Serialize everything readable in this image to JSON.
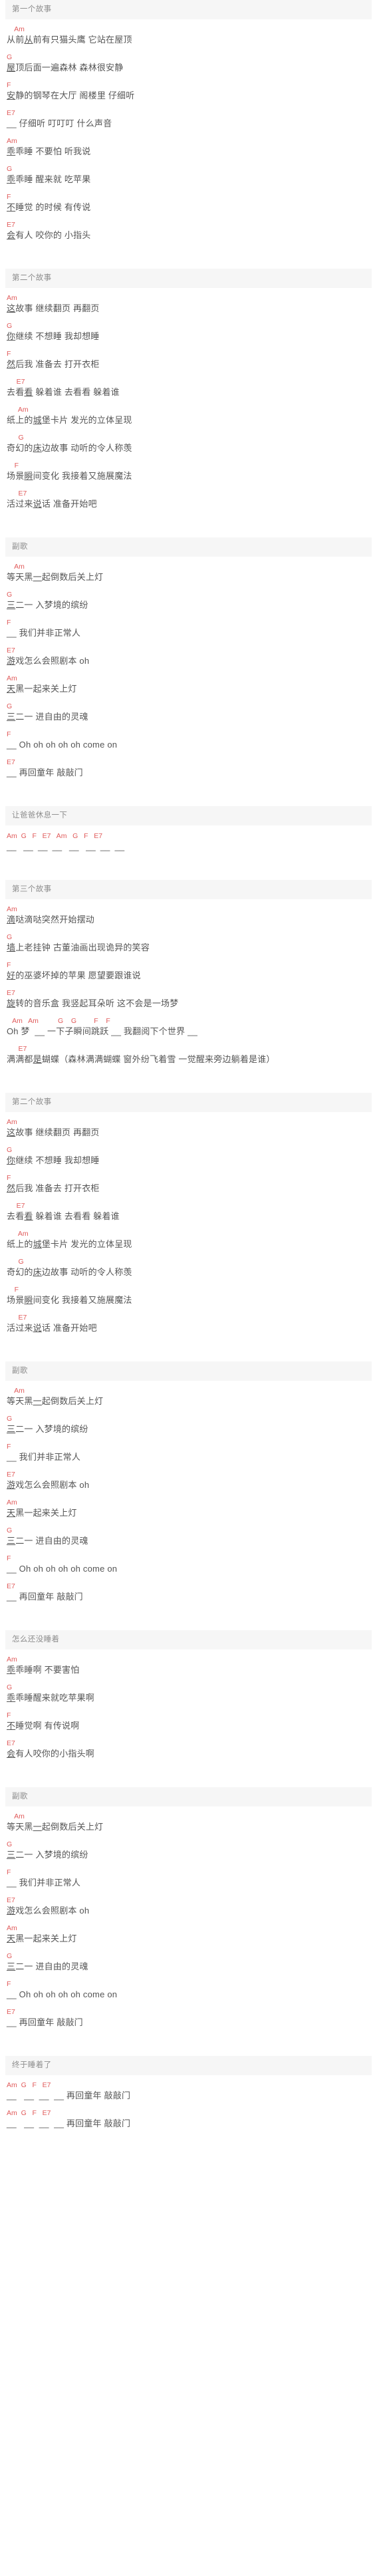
{
  "meta": {
    "chord_color": "#e05a5a",
    "lyric_color": "#555555",
    "header_bg": "#f6f6f6",
    "header_color": "#8d8d8d"
  },
  "sections": [
    {
      "title": "第一个故事",
      "lines": [
        {
          "chords": "    Am",
          "lyrics": "从前从前有只猫头鹰 它站在屋顶",
          "mark": 2
        },
        {
          "chords": "G",
          "lyrics": "屋顶后面一遍森林 森林很安静",
          "mark": 0
        },
        {
          "chords": "F",
          "lyrics": "安静的钢琴在大厅 阁楼里 仔细听",
          "mark": 0
        },
        {
          "chords": "E7",
          "lyrics": "__ 仔细听 叮叮叮 什么声音",
          "mark": -1
        },
        {
          "chords": "Am",
          "lyrics": "乖乖睡 不要怕 听我说",
          "mark": 0
        },
        {
          "chords": "G",
          "lyrics": "乖乖睡 醒来就 吃苹果",
          "mark": 0
        },
        {
          "chords": "F",
          "lyrics": "不睡觉 的时候 有传说",
          "mark": 0
        },
        {
          "chords": "E7",
          "lyrics": "会有人 咬你的 小指头",
          "mark": 0
        }
      ]
    },
    {
      "title": "第二个故事",
      "lines": [
        {
          "chords": "Am",
          "lyrics": "这故事 继续翻页 再翻页",
          "mark": 0
        },
        {
          "chords": "G",
          "lyrics": "你继续 不想睡 我却想睡",
          "mark": 0
        },
        {
          "chords": "F",
          "lyrics": "然后我 准备去 打开衣柜",
          "mark": 0
        },
        {
          "chords": "     E7",
          "lyrics": "去看看 躲着谁 去看看 躲着谁",
          "mark": 2
        },
        {
          "chords": "      Am",
          "lyrics": "纸上的城堡卡片 发光的立体呈现",
          "mark": 3
        },
        {
          "chords": "      G",
          "lyrics": "奇幻的床边故事 动听的令人称羡",
          "mark": 3
        },
        {
          "chords": "    F",
          "lyrics": "场景瞬间变化 我接着又施展魔法",
          "mark": 2
        },
        {
          "chords": "      E7",
          "lyrics": "活过来说话 准备开始吧",
          "mark": 3
        }
      ]
    },
    {
      "title": "副歌",
      "lines": [
        {
          "chords": "    Am",
          "lyrics": "等天黑一起倒数后关上灯",
          "mark": 3
        },
        {
          "chords": "G",
          "lyrics": "三二一 入梦境的缤纷",
          "mark": 0
        },
        {
          "chords": "F",
          "lyrics": "__ 我们并非正常人",
          "mark": -1
        },
        {
          "chords": "E7",
          "lyrics": "游戏怎么会照剧本 oh",
          "mark": 0
        },
        {
          "chords": "Am",
          "lyrics": "天黑一起来关上灯",
          "mark": 0
        },
        {
          "chords": "G",
          "lyrics": "三二一 进自由的灵魂",
          "mark": 0
        },
        {
          "chords": "F",
          "lyrics": "__ Oh oh oh oh oh come on",
          "mark": -1
        },
        {
          "chords": "E7",
          "lyrics": "__ 再回童年 敲敲门",
          "mark": -1
        }
      ]
    },
    {
      "title": "让爸爸休息一下",
      "instrumental": {
        "chords": "Am  G   F   E7   Am   G   F   E7",
        "dashes": "__   __  __  __   __   __  __  __"
      },
      "lines": []
    },
    {
      "title": "第三个故事",
      "lines": [
        {
          "chords": "Am",
          "lyrics": "滴哒滴哒突然开始摆动",
          "mark": 0
        },
        {
          "chords": "G",
          "lyrics": "墙上老挂钟 古董油画出现诡异的笑容",
          "mark": 0
        },
        {
          "chords": "F",
          "lyrics": "好的巫婆坏掉的苹果 愿望要跟谁说",
          "mark": 0
        },
        {
          "chords": "E7",
          "lyrics": "旋转的音乐盒 我竖起耳朵听 这不会是一场梦",
          "mark": 0
        },
        {
          "chords": "   Am   Am          G    G         F    F",
          "lyrics": "Oh 梦  __ 一下子瞬间跳跃 __ 我翻阅下个世界 __",
          "mark": -2
        },
        {
          "chords": "      E7",
          "lyrics": "满满都是蝴蝶（森林满满蝴蝶 窗外纷飞着雪 一觉醒来旁边躺着是谁）",
          "mark": 3
        }
      ]
    },
    {
      "title": "第二个故事",
      "lines": [
        {
          "chords": "Am",
          "lyrics": "这故事 继续翻页 再翻页",
          "mark": 0
        },
        {
          "chords": "G",
          "lyrics": "你继续 不想睡 我却想睡",
          "mark": 0
        },
        {
          "chords": "F",
          "lyrics": "然后我 准备去 打开衣柜",
          "mark": 0
        },
        {
          "chords": "     E7",
          "lyrics": "去看看 躲着谁 去看看 躲着谁",
          "mark": 2
        },
        {
          "chords": "      Am",
          "lyrics": "纸上的城堡卡片 发光的立体呈现",
          "mark": 3
        },
        {
          "chords": "      G",
          "lyrics": "奇幻的床边故事 动听的令人称羡",
          "mark": 3
        },
        {
          "chords": "    F",
          "lyrics": "场景瞬间变化 我接着又施展魔法",
          "mark": 2
        },
        {
          "chords": "      E7",
          "lyrics": "活过来说话 准备开始吧",
          "mark": 3
        }
      ]
    },
    {
      "title": "副歌",
      "lines": [
        {
          "chords": "    Am",
          "lyrics": "等天黑一起倒数后关上灯",
          "mark": 3
        },
        {
          "chords": "G",
          "lyrics": "三二一 入梦境的缤纷",
          "mark": 0
        },
        {
          "chords": "F",
          "lyrics": "__ 我们并非正常人",
          "mark": -1
        },
        {
          "chords": "E7",
          "lyrics": "游戏怎么会照剧本 oh",
          "mark": 0
        },
        {
          "chords": "Am",
          "lyrics": "天黑一起来关上灯",
          "mark": 0
        },
        {
          "chords": "G",
          "lyrics": "三二一 进自由的灵魂",
          "mark": 0
        },
        {
          "chords": "F",
          "lyrics": "__ Oh oh oh oh oh come on",
          "mark": -1
        },
        {
          "chords": "E7",
          "lyrics": "__ 再回童年 敲敲门",
          "mark": -1
        }
      ]
    },
    {
      "title": "怎么还没睡着",
      "lines": [
        {
          "chords": "Am",
          "lyrics": "乖乖睡啊 不要害怕",
          "mark": 0
        },
        {
          "chords": "G",
          "lyrics": "乖乖睡醒来就吃苹果啊",
          "mark": 0
        },
        {
          "chords": "F",
          "lyrics": "不睡觉啊 有传说啊",
          "mark": 0
        },
        {
          "chords": "E7",
          "lyrics": "会有人咬你的小指头啊",
          "mark": 0
        }
      ]
    },
    {
      "title": "副歌",
      "lines": [
        {
          "chords": "    Am",
          "lyrics": "等天黑一起倒数后关上灯",
          "mark": 3
        },
        {
          "chords": "G",
          "lyrics": "三二一 入梦境的缤纷",
          "mark": 0
        },
        {
          "chords": "F",
          "lyrics": "__ 我们并非正常人",
          "mark": -1
        },
        {
          "chords": "E7",
          "lyrics": "游戏怎么会照剧本 oh",
          "mark": 0
        },
        {
          "chords": "Am",
          "lyrics": "天黑一起来关上灯",
          "mark": 0
        },
        {
          "chords": "G",
          "lyrics": "三二一 进自由的灵魂",
          "mark": 0
        },
        {
          "chords": "F",
          "lyrics": "__ Oh oh oh oh oh come on",
          "mark": -1
        },
        {
          "chords": "E7",
          "lyrics": "__ 再回童年 敲敲门",
          "mark": -1
        }
      ]
    },
    {
      "title": "终于睡着了",
      "lines": [
        {
          "chords": "Am  G   F   E7",
          "lyrics": "__   __  __  __ 再回童年 敲敲门",
          "mark": -2
        },
        {
          "chords": "Am  G   F   E7",
          "lyrics": "__   __  __  __ 再回童年 敲敲门",
          "mark": -2
        }
      ]
    }
  ]
}
